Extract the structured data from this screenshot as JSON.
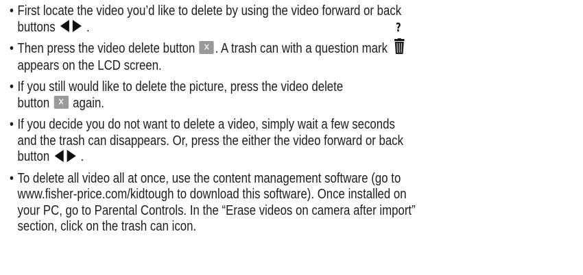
{
  "bullet_char": "•",
  "icons": {
    "back": "back-arrow-icon",
    "forward": "forward-arrow-icon",
    "delete": "delete-x-icon",
    "delete_glyph": "✕",
    "trash": "trash-can-question-icon",
    "trash_question": "?",
    "color_dark": "#111111",
    "color_button": "#9a9a9a"
  },
  "instructions": {
    "item1": {
      "line1": "First locate the video you’d like to delete by using the video forward or back",
      "line2": "buttons",
      "end": "."
    },
    "item2": {
      "line1_a": "Then press the video delete button",
      "line1_b": ". A trash can with a question mark",
      "line2": "appears on the LCD screen."
    },
    "item3": {
      "line1": "If you still would like to delete the picture, press the video delete",
      "line2_a": "button",
      "line2_b": "again."
    },
    "item4": {
      "line1": "If you decide you do not want to delete a video, simply wait a few seconds",
      "line2": "and the trash can disappears. Or, press the either the video forward or back",
      "line3": "button",
      "end": "."
    },
    "item5": {
      "line1": "To delete all video all at once, use the content management software (go to",
      "line2": "www.fisher-price.com/kidtough to download this software). Once installed on",
      "line3": "your PC, go to Parental Controls. In the “Erase videos on camera after import”",
      "line4": "section, click on the trash can icon."
    }
  }
}
